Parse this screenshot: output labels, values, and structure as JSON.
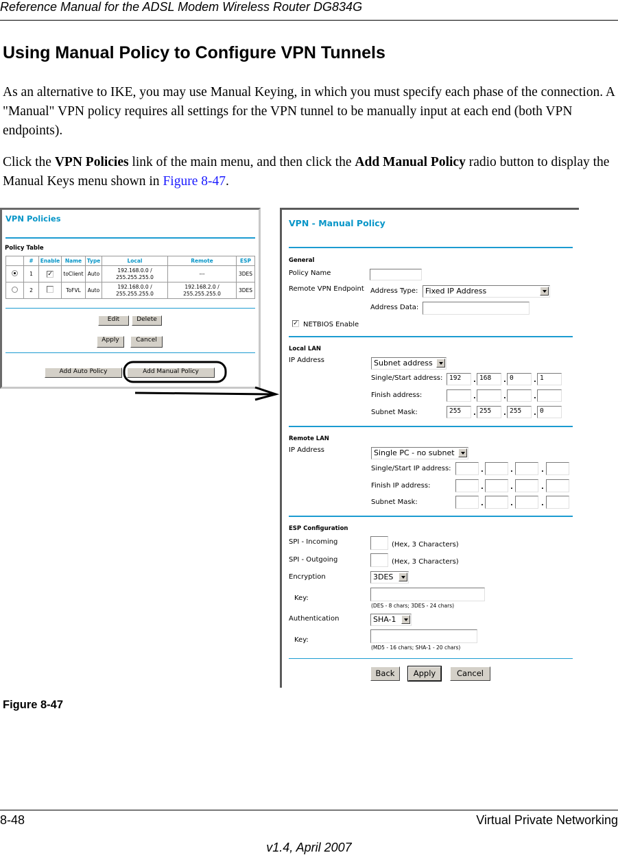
{
  "page": {
    "running_header": "Reference Manual for the ADSL Modem Wireless Router DG834G",
    "title": "Using Manual Policy to Configure VPN Tunnels",
    "paragraph1": "As an alternative to IKE, you may use Manual Keying, in which you must specify each phase of the connection. A \"Manual\" VPN policy requires all settings for the VPN tunnel to be manually input at each end (both VPN endpoints).",
    "paragraph2": {
      "t1": "Click the ",
      "b1": "VPN Policies",
      "t2": " link of the main menu, and then click the ",
      "b2": "Add Manual Policy",
      "t3": " radio button to display the Manual Keys menu shown in ",
      "link": "Figure 8-47",
      "t4": "."
    },
    "figure_caption": "Figure 8-47",
    "footer_left": "8-48",
    "footer_right": "Virtual Private Networking",
    "footer_version": "v1.4, April 2007",
    "link_color": "#1a1aff"
  },
  "vpn_policies": {
    "title": "VPN Policies",
    "table_label": "Policy Table",
    "columns": [
      "",
      "#",
      "Enable",
      "Name",
      "Type",
      "Local",
      "Remote",
      "ESP"
    ],
    "rows": [
      {
        "selected": true,
        "num": "1",
        "enabled": true,
        "name": "toClient",
        "type": "Auto",
        "local1": "192.168.0.0 /",
        "local2": "255.255.255.0",
        "remote1": "---",
        "remote2": "",
        "esp": "3DES"
      },
      {
        "selected": false,
        "num": "2",
        "enabled": false,
        "name": "ToFVL",
        "type": "Auto",
        "local1": "192.168.0.0 /",
        "local2": "255.255.255.0",
        "remote1": "192.168.2.0 /",
        "remote2": "255.255.255.0",
        "esp": "3DES"
      }
    ],
    "buttons": {
      "edit": "Edit",
      "delete": "Delete",
      "apply": "Apply",
      "cancel": "Cancel",
      "add_auto": "Add Auto Policy",
      "add_manual": "Add Manual Policy"
    }
  },
  "manual_policy": {
    "title": "VPN - Manual Policy",
    "accent_color": "#1b9bd1",
    "general": {
      "heading": "General",
      "policy_name_label": "Policy Name",
      "policy_name_value": "",
      "remote_endpoint_label": "Remote VPN Endpoint",
      "address_type_label": "Address Type:",
      "address_type_value": "Fixed IP Address",
      "address_data_label": "Address Data:",
      "address_data_value": "",
      "netbios_label": "NETBIOS Enable",
      "netbios_checked": true
    },
    "local_lan": {
      "heading": "Local LAN",
      "ip_label": "IP Address",
      "ip_type": "Subnet address",
      "start_label": "Single/Start address:",
      "start": [
        "192",
        "168",
        "0",
        "1"
      ],
      "finish_label": "Finish address:",
      "finish": [
        "",
        "",
        "",
        ""
      ],
      "mask_label": "Subnet Mask:",
      "mask": [
        "255",
        "255",
        "255",
        "0"
      ]
    },
    "remote_lan": {
      "heading": "Remote LAN",
      "ip_label": "IP Address",
      "ip_type": "Single PC - no subnet",
      "start_label": "Single/Start IP address:",
      "start": [
        "",
        "",
        "",
        ""
      ],
      "finish_label": "Finish IP address:",
      "finish": [
        "",
        "",
        "",
        ""
      ],
      "mask_label": "Subnet Mask:",
      "mask": [
        "",
        "",
        "",
        ""
      ]
    },
    "esp": {
      "heading": "ESP Configuration",
      "spi_in_label": "SPI - Incoming",
      "spi_in_value": "",
      "spi_out_label": "SPI - Outgoing",
      "spi_out_value": "",
      "spi_hint": "(Hex, 3 Characters)",
      "encryption_label": "Encryption",
      "encryption_value": "3DES",
      "enc_key_label": "Key:",
      "enc_key_value": "",
      "enc_key_hint": "(DES - 8 chars;   3DES - 24 chars)",
      "auth_label": "Authentication",
      "auth_value": "SHA-1",
      "auth_key_label": "Key:",
      "auth_key_value": "",
      "auth_key_hint": "(MD5 - 16 chars;   SHA-1 - 20 chars)"
    },
    "buttons": {
      "back": "Back",
      "apply": "Apply",
      "cancel": "Cancel"
    }
  }
}
